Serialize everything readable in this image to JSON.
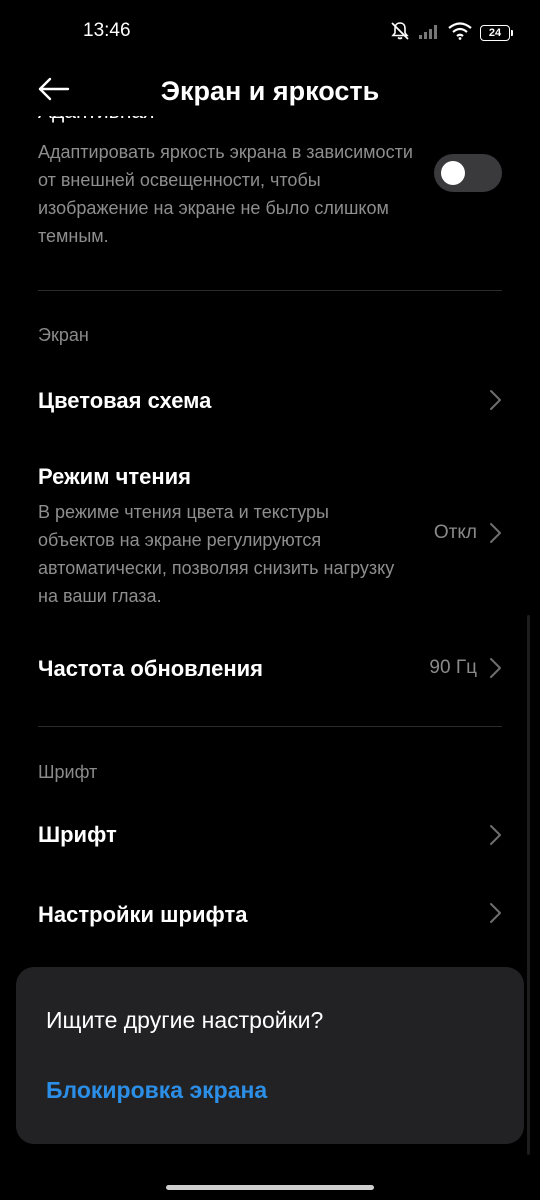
{
  "status_bar": {
    "time": "13:46",
    "battery": "24",
    "icons": [
      "bell-off-icon",
      "signal-icon",
      "wifi-icon",
      "battery-icon"
    ]
  },
  "header": {
    "title": "Экран и яркость",
    "back_icon": "arrow-left-icon"
  },
  "adaptive_brightness": {
    "title_partial": "Адаптивная яркость",
    "description": "Адаптировать яркость экрана в зависимости от внешней освещенности, чтобы изображение на экране не было слишком темным.",
    "enabled": false
  },
  "sections": {
    "screen": {
      "label": "Экран",
      "color_scheme": {
        "title": "Цветовая схема"
      },
      "reading_mode": {
        "title": "Режим чтения",
        "description": "В режиме чтения цвета и текстуры объектов на экране регулируются автоматически, позволяя снизить нагрузку на ваши глаза.",
        "value": "Откл"
      },
      "refresh_rate": {
        "title": "Частота обновления",
        "value": "90 Гц"
      }
    },
    "font": {
      "label": "Шрифт",
      "font_item": {
        "title": "Шрифт"
      },
      "font_settings": {
        "title": "Настройки шрифта"
      }
    }
  },
  "bottom_card": {
    "question": "Ищите другие настройки?",
    "link": "Блокировка экрана"
  },
  "colors": {
    "background": "#000000",
    "text_primary": "#ffffff",
    "text_secondary": "#8e8e8e",
    "accent": "#2c8fe7",
    "card": "#222224",
    "toggle_off": "#3a3a3c"
  }
}
